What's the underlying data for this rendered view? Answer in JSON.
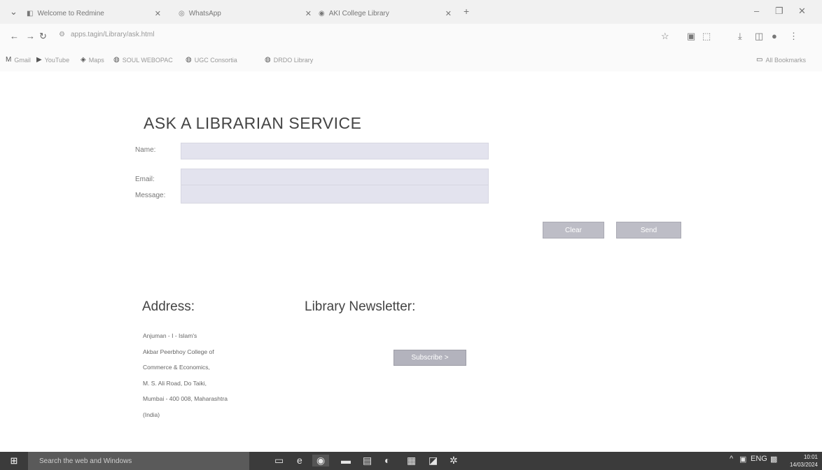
{
  "browser": {
    "tabs": [
      {
        "label": "Welcome to Redmine"
      },
      {
        "label": "WhatsApp"
      },
      {
        "label": "AKI College Library"
      }
    ],
    "url": "apps.tagin/Library/ask.html",
    "bookmarks": [
      "Gmail",
      "YouTube",
      "Maps",
      "SOUL WEBOPAC",
      "UGC Consortia",
      "DRDO Library"
    ],
    "all_bookmarks": "All Bookmarks"
  },
  "page": {
    "title": "ASK A LIBRARIAN SERVICE",
    "form": {
      "name_label": "Name:",
      "email_label": "Email:",
      "message_label": "Message:",
      "clear_label": "Clear",
      "send_label": "Send"
    },
    "address": {
      "heading": "Address:",
      "lines": [
        "Anjuman - I - Islam's",
        "Akbar Peerbhoy College of",
        "Commerce & Economics,",
        "M. S. Ali Road, Do Taiki,",
        "Mumbai - 400 008, Maharashtra",
        "(India)"
      ]
    },
    "newsletter": {
      "heading": "Library Newsletter:",
      "subscribe_label": "Subscribe >"
    }
  },
  "taskbar": {
    "search_placeholder": "Search the web and Windows",
    "tray_text": "ENG",
    "time": "10:01",
    "date": "14/03/2024"
  }
}
